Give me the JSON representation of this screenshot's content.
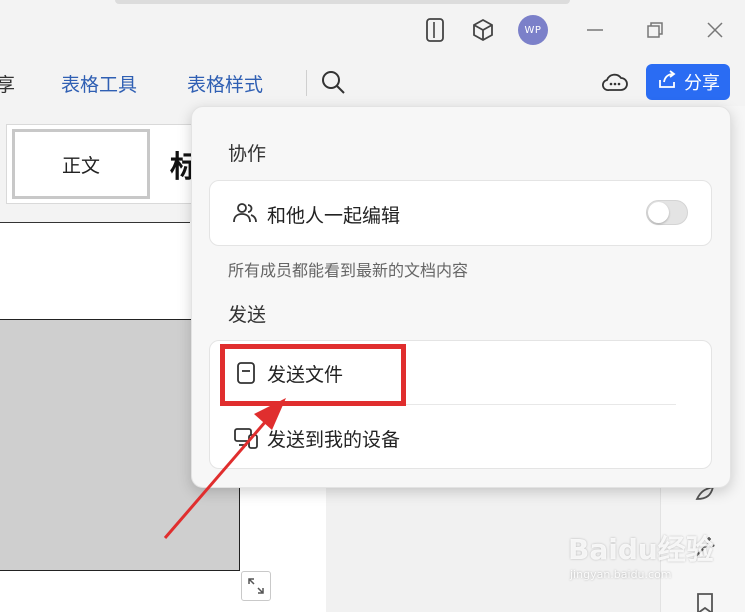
{
  "titlebar": {
    "avatar_initials": "WP",
    "icons": [
      "tablet-icon",
      "cube-icon",
      "minimize-icon",
      "restore-icon",
      "close-icon"
    ]
  },
  "ribbon": {
    "tabs": [
      {
        "label": "享"
      },
      {
        "label": "表格工具"
      },
      {
        "label": "表格样式"
      }
    ],
    "share_label": "分享",
    "accent_color": "#2a6cf3"
  },
  "document": {
    "style_label": "正文",
    "style_next_partial": "标"
  },
  "share_panel": {
    "collab_heading": "协作",
    "collab_edit_label": "和他人一起编辑",
    "collab_desc": "所有成员都能看到最新的文档内容",
    "send_heading": "发送",
    "send_file_label": "发送文件",
    "send_device_label": "发送到我的设备"
  },
  "annotation_color": "#e02e2e",
  "watermark": {
    "text": "Baidu经验",
    "sub": "jingyan.baidu.com"
  }
}
